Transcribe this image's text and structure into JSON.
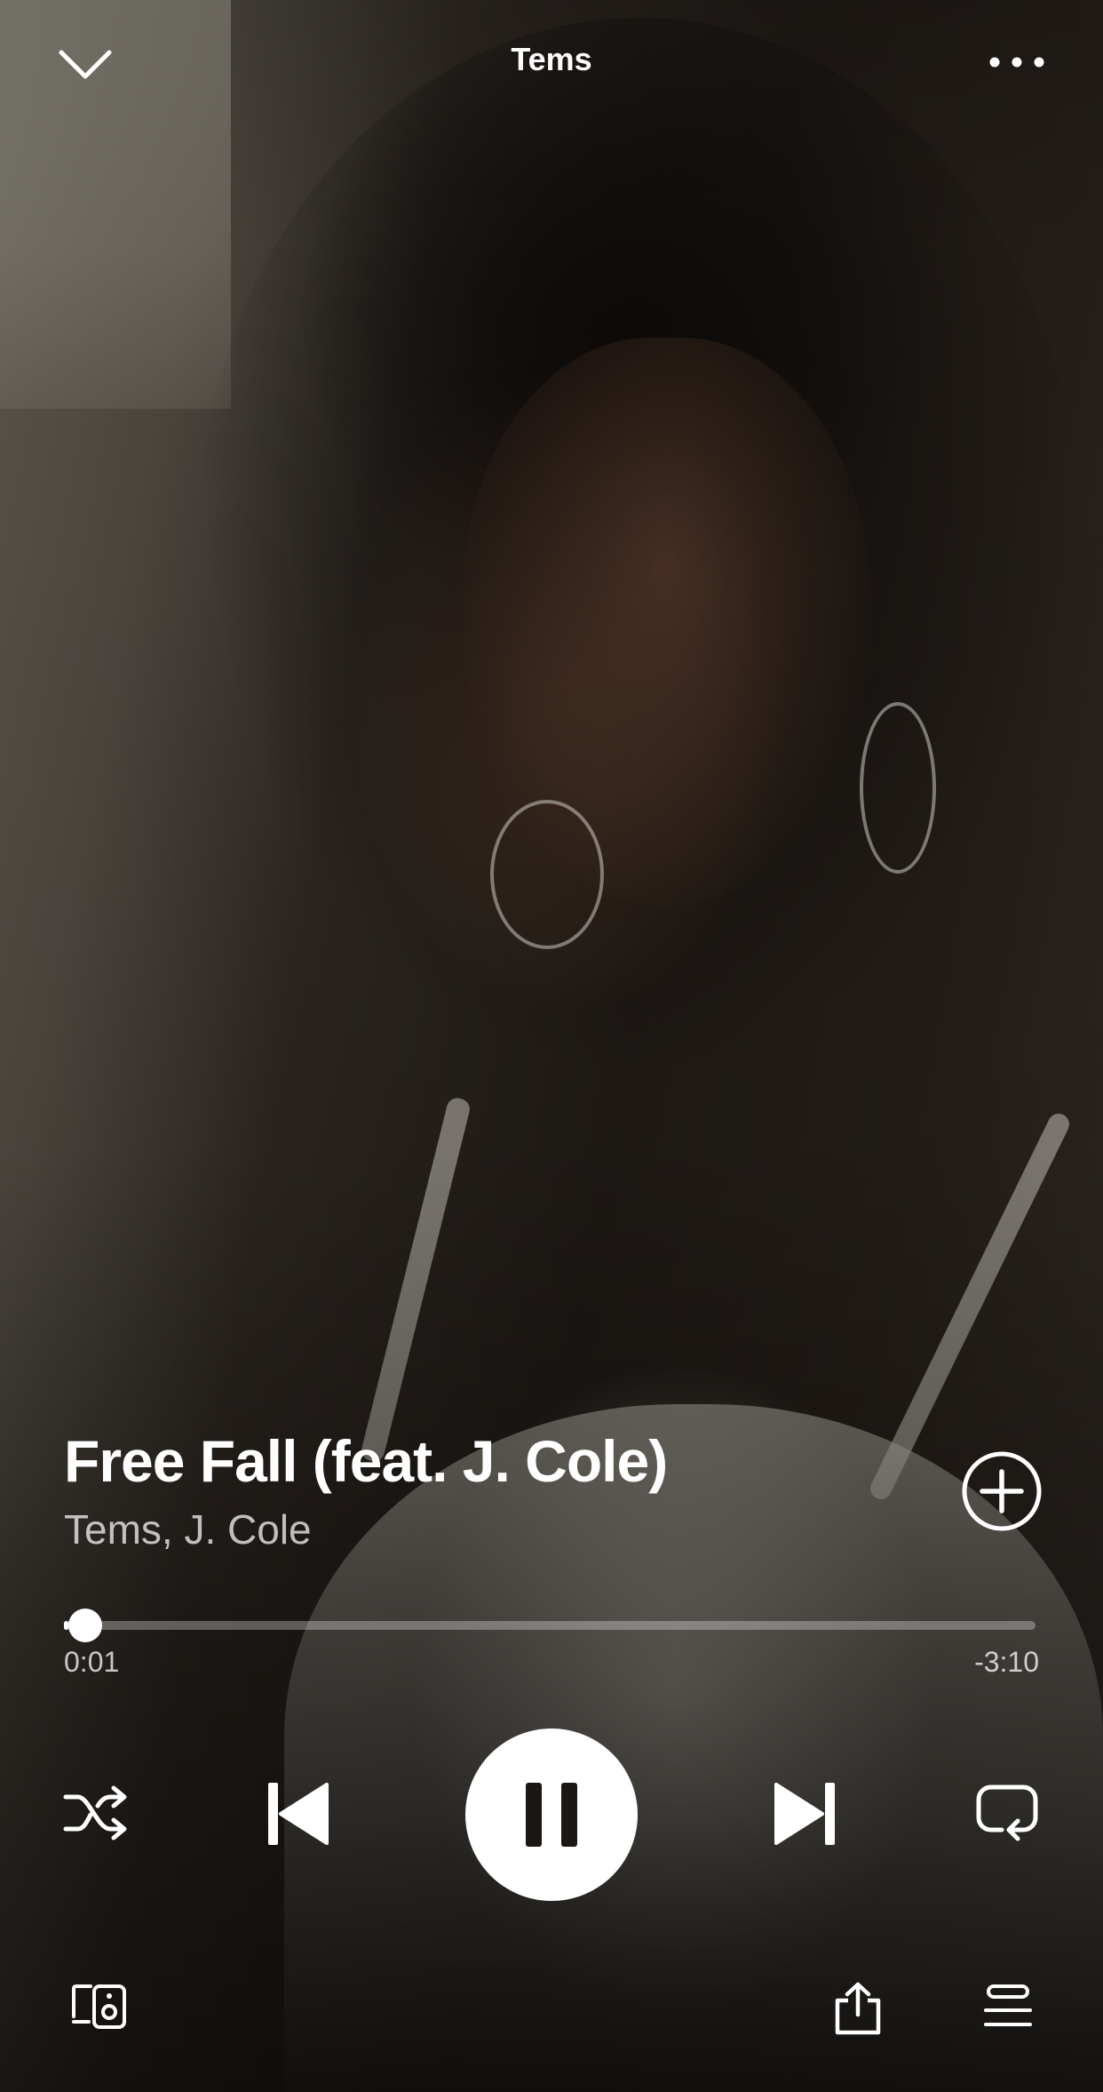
{
  "header": {
    "title": "Tems",
    "collapse_icon": "chevron-down-icon",
    "more_icon": "more-horizontal-icon"
  },
  "track": {
    "title": "Free Fall (feat. J. Cole)",
    "artists": "Tems, J. Cole",
    "add_icon": "plus-circle-icon"
  },
  "playback": {
    "elapsed": "0:01",
    "remaining": "-3:10",
    "progress_fraction": 0.005
  },
  "controls": {
    "shuffle_icon": "shuffle-icon",
    "previous_icon": "skip-previous-icon",
    "play_state_icon": "pause-icon",
    "next_icon": "skip-next-icon",
    "repeat_icon": "repeat-icon"
  },
  "bottom_bar": {
    "devices_icon": "connect-devices-icon",
    "share_icon": "share-icon",
    "queue_icon": "queue-icon"
  },
  "colors": {
    "foreground": "#ffffff",
    "secondary_text": "#b8b8b8",
    "progress_track": "#5c5a57"
  }
}
